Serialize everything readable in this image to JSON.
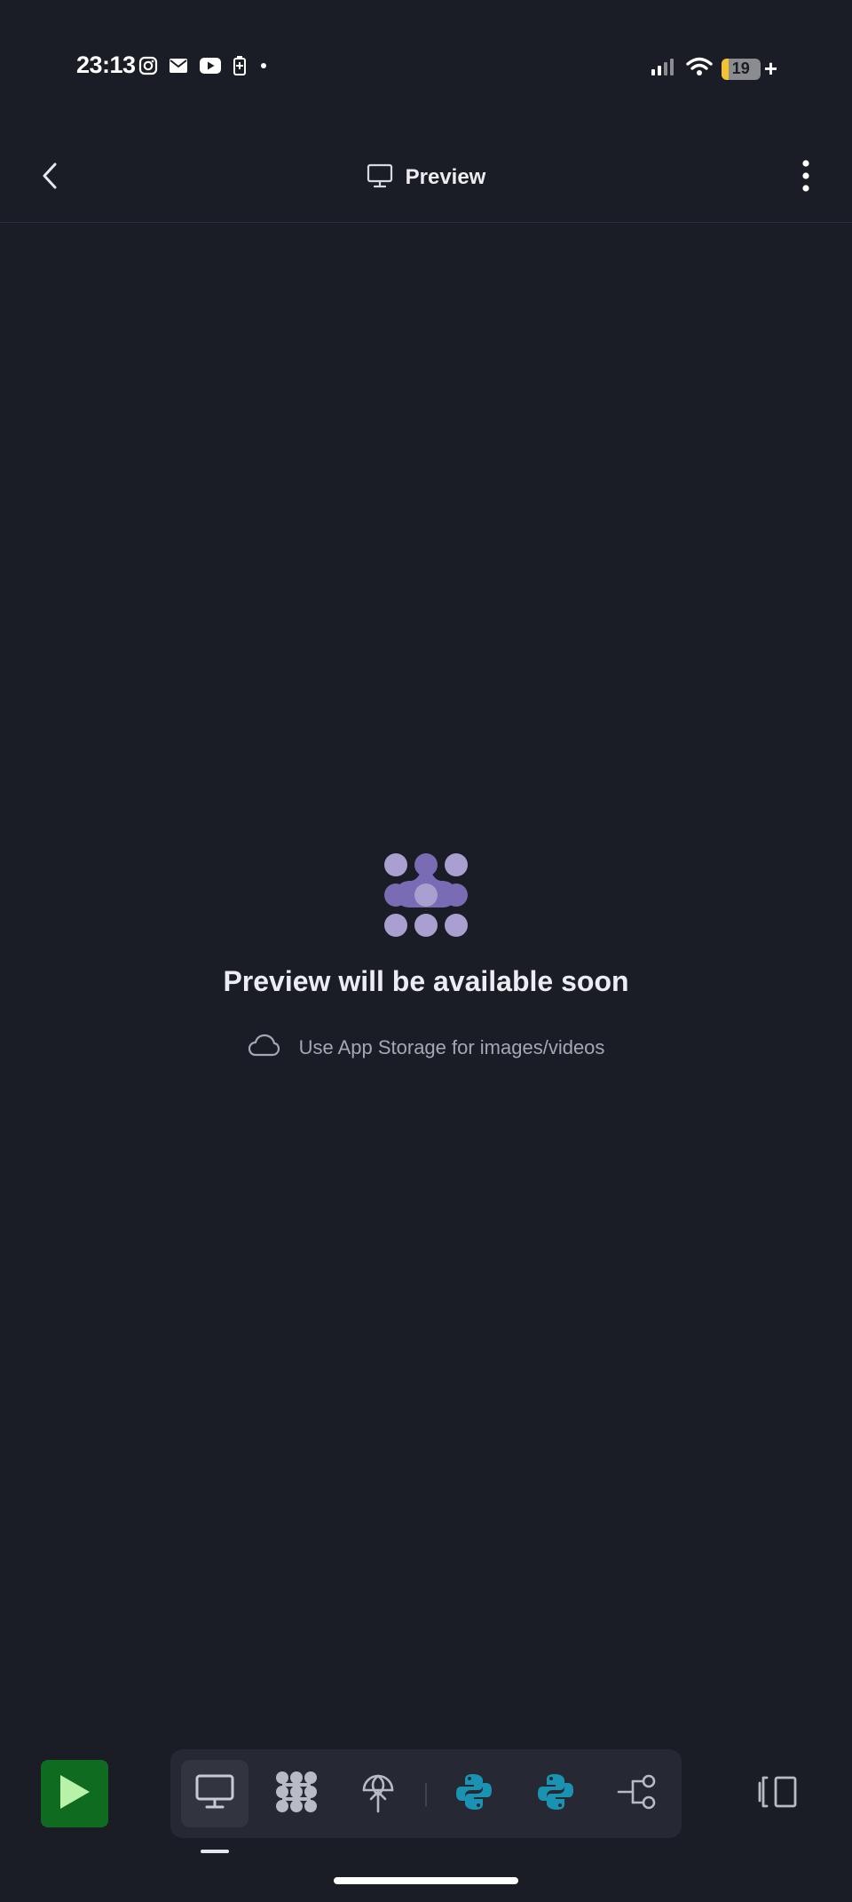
{
  "status_bar": {
    "time": "23:13",
    "battery_level": "19",
    "battery_fraction": 0.19,
    "charging_symbol": "+",
    "notification_icons": [
      "instagram-icon",
      "mail-icon",
      "youtube-icon",
      "battery-saver-icon",
      "dot-icon"
    ],
    "system_icons": [
      "signal-icon",
      "wifi-icon",
      "battery-icon"
    ]
  },
  "header": {
    "title": "Preview",
    "title_icon": "monitor-icon",
    "back_icon": "chevron-left-icon",
    "menu_icon": "more-vertical-icon"
  },
  "empty_state": {
    "logo": "app-logo-icon",
    "title": "Preview will be available soon",
    "hint_icon": "cloud-icon",
    "hint_text": "Use App Storage for images/videos"
  },
  "toolbar": {
    "run_icon": "play-icon",
    "tools": [
      {
        "name": "preview",
        "icon": "monitor-icon",
        "active": true
      },
      {
        "name": "packages",
        "icon": "dots-grid-icon",
        "active": false
      },
      {
        "name": "deploy",
        "icon": "antenna-icon",
        "active": false
      },
      {
        "name": "python-1",
        "icon": "python-icon",
        "active": false
      },
      {
        "name": "python-2",
        "icon": "python-icon",
        "active": false
      },
      {
        "name": "git",
        "icon": "git-branch-icon",
        "active": false
      }
    ],
    "panel_icon": "panel-toggle-icon"
  },
  "colors": {
    "background": "#1b1d26",
    "accent_green": "#0e6b1f",
    "logo_purple": "#7a6bb5",
    "logo_light": "#a99fd0",
    "python_blue": "#1a93b2"
  }
}
